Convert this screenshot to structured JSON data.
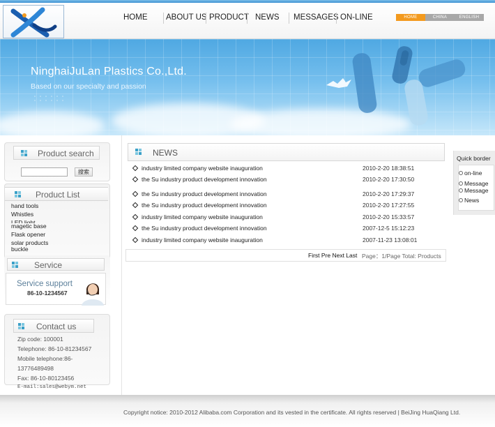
{
  "header": {
    "nav": [
      "HOME",
      "ABOUT US",
      "PRODUCT",
      "NEWS",
      "MESSAGES",
      "ON-LINE"
    ],
    "lang": [
      "HOME",
      "CHINA",
      "ENGLISH"
    ],
    "colors": {
      "lang_home": "#f39a1e",
      "lang_china": "#a8a8a8",
      "lang_english": "#a8a8a8"
    }
  },
  "banner": {
    "company": "NinghaiJuLan Plastics Co.,Ltd.",
    "slogan": "Based on our specialty and passion"
  },
  "sidebar": {
    "search": {
      "title": "Product search",
      "button": "搜索",
      "value": ""
    },
    "products": {
      "title": "Product  List",
      "items": [
        "hand tools",
        "Whistles",
        "LED light",
        "magetic base",
        "Flask opener",
        "solar products",
        "buckle"
      ]
    },
    "service": {
      "title": "Service",
      "support": "Service support",
      "phone": "86-10-1234567"
    },
    "contact": {
      "title": "Contact us",
      "zip": "Zip code: 100001",
      "telephone": "Telephone: 86-10-81234567",
      "mobile_label": "Mobile telephone:86-",
      "mobile_number": "13776489498",
      "fax": "Fax: 86-10-80123456",
      "email": "E-mail:sales@webym.net"
    }
  },
  "news": {
    "title": "NEWS",
    "items": [
      {
        "title": "industry limited company website inauguration",
        "date": "2010-2-20 18:38:51"
      },
      {
        "title": "the Su industry product development innovation",
        "date": "2010-2-20 17:30:50"
      },
      {
        "title": "the Su industry product development innovation",
        "date": "2010-2-20 17:29:37"
      },
      {
        "title": "the Su industry product development innovation",
        "date": "2010-2-20 17:27:55"
      },
      {
        "title": "industry limited company website inauguration",
        "date": "2010-2-20 15:33:57"
      },
      {
        "title": "the Su industry product development innovation",
        "date": "2007-12-5 15:12:23"
      },
      {
        "title": "industry limited company website inauguration",
        "date": "2007-11-23 13:08:01"
      }
    ],
    "pager": {
      "links": "First Pre Next Last",
      "info": "Page：1/Page Total: Products"
    }
  },
  "quick": {
    "title": "Quick border",
    "items": [
      "on-line",
      "Message",
      "Message",
      "News"
    ]
  },
  "footer": {
    "copyright": "Copyright notice: 2010-2012 Alibaba.com Corporation and its vested in the certificate. All rights reserved | BeiJing HuaQiang Ltd."
  }
}
